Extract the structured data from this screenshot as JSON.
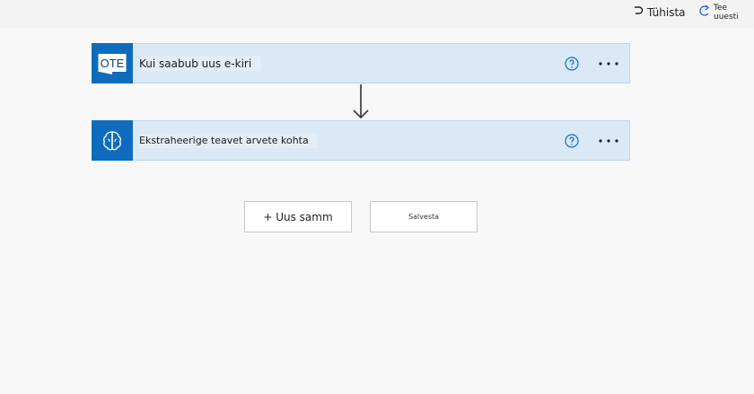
{
  "toolbar": {
    "undo_label": "Tühista",
    "redo_label": "Tee uuesti"
  },
  "flow": {
    "steps": [
      {
        "icon": "outlook-icon",
        "icon_text": "OTE",
        "title": "Kui saabub uus e-kiri"
      },
      {
        "icon": "ai-builder-brain-icon",
        "title": "Ekstraheerige teavet arvete kohta"
      }
    ]
  },
  "actions": {
    "new_step_label": "+ Uus samm",
    "save_label": "Salvesta"
  },
  "colors": {
    "accent": "#0f6cbd",
    "card_background": "#dbe9f6",
    "card_border": "#bcd3ea",
    "page_background": "#f8f8f8"
  }
}
